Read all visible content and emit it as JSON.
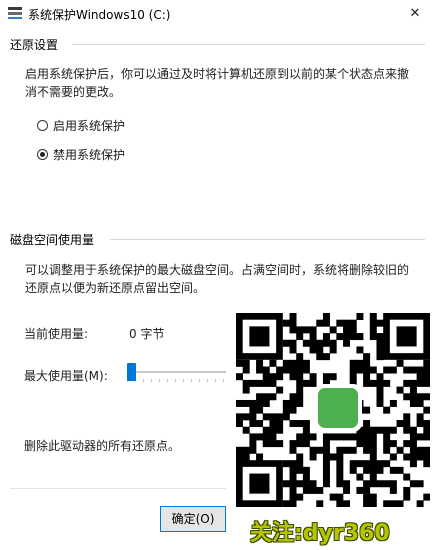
{
  "window": {
    "title": "系统保护Windows10 (C:)",
    "close_glyph": "✕"
  },
  "restore_settings": {
    "heading": "还原设置",
    "description": "启用系统保护后，你可以通过及时将计算机还原到以前的某个状态点来撤消不需要的更改。",
    "options": [
      {
        "label": "启用系统保护",
        "checked": false
      },
      {
        "label": "禁用系统保护",
        "checked": true
      }
    ]
  },
  "disk_usage": {
    "heading": "磁盘空间使用量",
    "description": "可以调整用于系统保护的最大磁盘空间。占满空间时，系统将删除较旧的还原点以便为新还原点留出空间。",
    "current_usage_label": "当前使用量:",
    "current_usage_value": "0 字节",
    "max_usage_label": "最大使用量(M):",
    "max_usage_slider_fraction": 0.0,
    "delete_text": "删除此驱动器的所有还原点。"
  },
  "footer": {
    "ok_label": "确定(O)"
  },
  "overlay": {
    "caption": "关注:dyr360"
  },
  "colors": {
    "accent": "#0078d7",
    "caption": "#b8c400",
    "logo": "#4caf50"
  },
  "icons": {
    "app": "system-protection-icon",
    "close": "close-icon"
  }
}
